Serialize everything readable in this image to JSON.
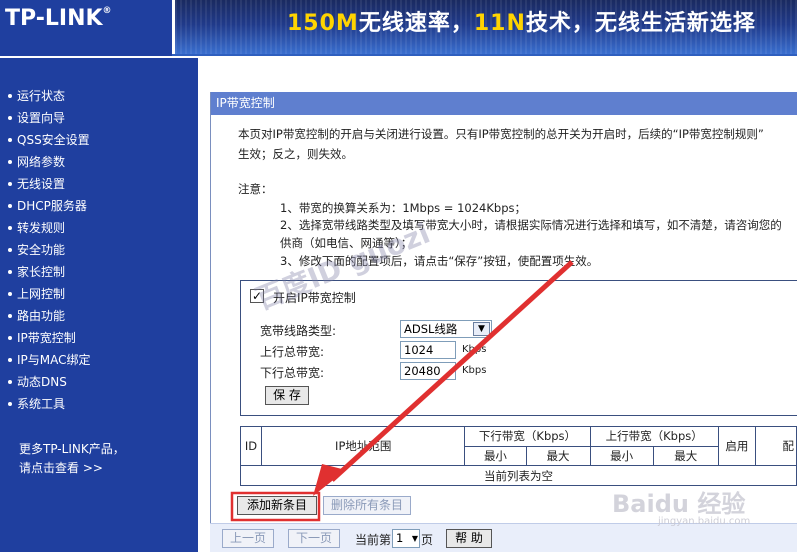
{
  "header": {
    "logo": "TP-LINK",
    "logo_reg": "®",
    "slogan_part1": "150M",
    "slogan_part2": "无线速率，",
    "slogan_part3": "11N",
    "slogan_part4": "技术，无线生活新选择"
  },
  "sidebar": {
    "items": [
      {
        "label": "运行状态"
      },
      {
        "label": "设置向导"
      },
      {
        "label": "QSS安全设置"
      },
      {
        "label": "网络参数"
      },
      {
        "label": "无线设置"
      },
      {
        "label": "DHCP服务器"
      },
      {
        "label": "转发规则"
      },
      {
        "label": "安全功能"
      },
      {
        "label": "家长控制"
      },
      {
        "label": "上网控制"
      },
      {
        "label": "路由功能"
      },
      {
        "label": "IP带宽控制"
      },
      {
        "label": "IP与MAC绑定"
      },
      {
        "label": "动态DNS"
      },
      {
        "label": "系统工具"
      }
    ],
    "more_line1": "更多TP-LINK产品，",
    "more_line2": "请点击查看 >>"
  },
  "panel": {
    "title": "IP带宽控制",
    "desc_line1": "本页对IP带宽控制的开启与关闭进行设置。只有IP带宽控制的总开关为开启时，后续的“IP带宽控制规则”",
    "desc_line2": "生效；反之，则失效。",
    "note_title": "注意：",
    "note1": "1、带宽的换算关系为：1Mbps = 1024Kbps；",
    "note2a": "2、选择宽带线路类型及填写带宽大小时，请根据实际情况进行选择和填写，如不清楚，请咨询您的",
    "note2b": "供商（如电信、网通等）；",
    "note3": "3、修改下面的配置项后，请点击“保存”按钮，使配置项生效。"
  },
  "control": {
    "checkbox_mark": "✓",
    "enable_label": "开启IP带宽控制",
    "line_type_label": "宽带线路类型:",
    "line_type_value": "ADSL线路",
    "up_label": "上行总带宽:",
    "up_value": "1024",
    "up_unit": "Kbps",
    "down_label": "下行总带宽:",
    "down_value": "20480",
    "down_unit": "Kbps",
    "save_button": "保 存"
  },
  "table": {
    "col_id": "ID",
    "col_ip": "IP地址范围",
    "col_down": "下行带宽（Kbps）",
    "col_up": "上行带宽（Kbps）",
    "col_enable": "启用",
    "col_config": "配",
    "min": "最小",
    "max": "最大",
    "empty": "当前列表为空"
  },
  "actions": {
    "add": "添加新条目",
    "delete_all": "删除所有条目"
  },
  "pager": {
    "prev": "上一页",
    "next": "下一页",
    "current_prefix": "当前第",
    "page": "1",
    "page_suffix": "页",
    "help": "帮 助"
  },
  "watermarks": {
    "baidu_id": "百度ID guozi",
    "baidu_logo": "Baidu 经验",
    "baidu_url": "jingyan.baidu.com"
  },
  "colors": {
    "sidebar_bg": "#1f3f9f",
    "panel_title_bg": "#5f7fcf",
    "arrow": "#e03030"
  }
}
